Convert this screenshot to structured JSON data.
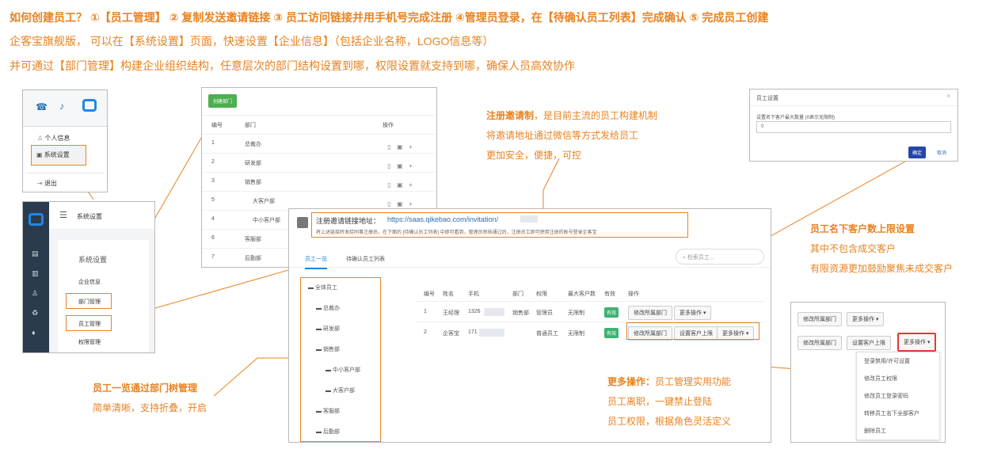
{
  "header": {
    "title": "如何创建员工？ ①【员工管理】 ② 复制发送邀请链接 ③ 员工访问链接并用手机号完成注册 ④管理员登录，在【待确认员工列表】完成确认 ⑤ 完成员工创建",
    "line1": "企客宝旗舰版， 可以在【系统设置】页面，快速设置【企业信息】（包括企业名称，LOGO信息等）",
    "line2": "并可通过【部门管理】构建企业组织结构，任意层次的部门结构设置到哪，权限设置就支持到哪，确保人员高效协作"
  },
  "user_menu": {
    "items": [
      "个人信息",
      "系统设置",
      "退出"
    ]
  },
  "settings_sidebar": {
    "title": "系统设置",
    "panel_title": "系统设置",
    "items": [
      "企业信息",
      "部门管理",
      "员工管理",
      "权限管理"
    ]
  },
  "dept_panel": {
    "create_button": "创建部门",
    "headers": [
      "编号",
      "部门",
      "操作"
    ],
    "rows": [
      {
        "num": "1",
        "name": "总裁办"
      },
      {
        "num": "2",
        "name": "研发部"
      },
      {
        "num": "3",
        "name": "销售部"
      },
      {
        "num": "4",
        "name": "大客户部"
      },
      {
        "num": "5",
        "name": "中小客户部"
      },
      {
        "num": "6",
        "name": "客服部"
      },
      {
        "num": "7",
        "name": "后勤部"
      }
    ],
    "row_nums": [
      "1",
      "2",
      "3",
      "5",
      "4",
      "6",
      "7"
    ]
  },
  "invite_note": {
    "line1_bold": "注册邀请制",
    "line1_rest": "，是目前主流的员工构建机制",
    "line2": "将邀请地址通过微信等方式发给员工",
    "line3": "更加安全，便捷，可控"
  },
  "employee_panel": {
    "invite_label": "注册邀请链接地址：",
    "invite_url": "https://saas.qikebao.com/invitation/",
    "invite_desc": "将上述链接转发给同事注册后，在下面的 [待确认员工列表] 中即可看到，管理员审核通过后，注册员工即可使用注册的账号登录企客宝",
    "tabs": [
      "员工一览",
      "待确认员工列表"
    ],
    "search_placeholder": "检索员工...",
    "tree": [
      "全体员工",
      "总裁办",
      "研发部",
      "销售部",
      "中小客户部",
      "大客户部",
      "客服部",
      "后勤部"
    ],
    "headers": [
      "编号",
      "姓名",
      "手机",
      "部门",
      "权限",
      "最大客户数",
      "有效",
      "操作"
    ],
    "rows": [
      {
        "num": "1",
        "name": "王经理",
        "phone": "1326",
        "dept": "销售部",
        "role": "管理员",
        "max": "无限制",
        "valid": "有效"
      },
      {
        "num": "2",
        "name": "企客宝",
        "phone": "171",
        "dept": "",
        "role": "普通员工",
        "max": "无限制",
        "valid": "有效"
      }
    ],
    "btn_dept": "修改所属部门",
    "btn_more": "更多操作 ▾",
    "btn_limit": "设置客户上限"
  },
  "limit_dialog": {
    "title": "员工设置",
    "close": "×",
    "label": "设置名下客户最大数量 (0表示无限制)",
    "value": "0",
    "confirm": "确定",
    "cancel": "取消"
  },
  "limit_note": {
    "title": "员工名下客户数上限设置",
    "line1": "其中不包含成交客户",
    "line2": "有限资源更加鼓励聚焦未成交客户"
  },
  "tree_note": {
    "title": "员工一览通过部门树管理",
    "line1": "简单清晰，支持折叠，开启"
  },
  "more_note": {
    "title_bold": "更多操作：",
    "title_rest": "员工管理实用功能",
    "line1": "员工离职，一键禁止登陆",
    "line2": "员工权限，根据角色灵活定义"
  },
  "more_menu": {
    "btn_dept": "修改所属部门",
    "btn_more": "更多操作 ▾",
    "btn_limit": "设置客户上限",
    "items": [
      "登录禁用/许可设置",
      "修改员工权限",
      "修改员工登录密码",
      "转移员工名下全部客户",
      "删除员工"
    ]
  },
  "colors": {
    "accent": "#e8821f",
    "blue": "#1e88e5",
    "green": "#3cb371",
    "navy": "#2a3b4d"
  }
}
